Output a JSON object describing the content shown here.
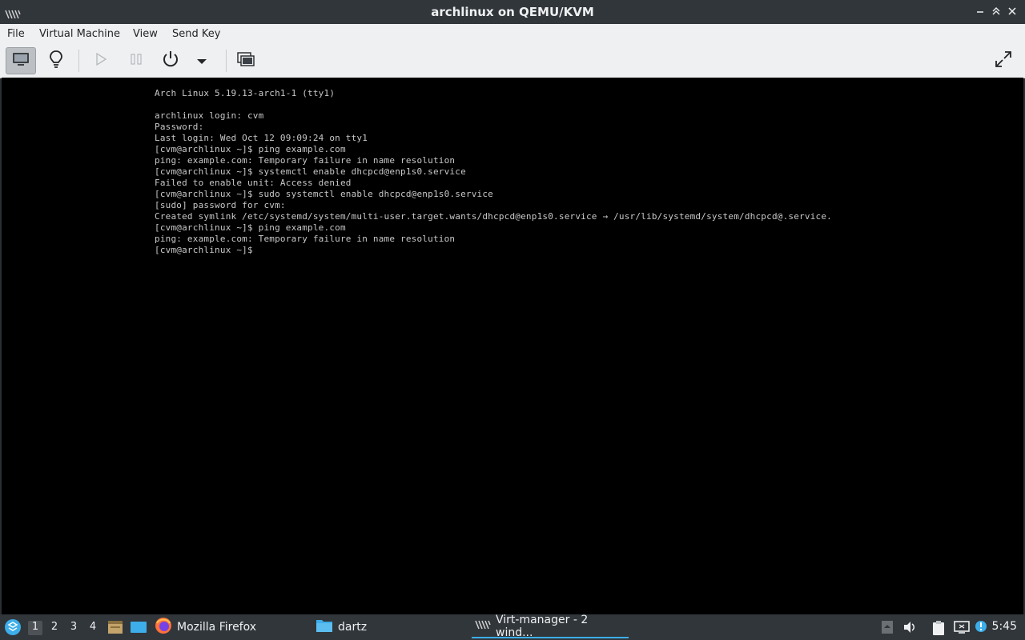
{
  "window": {
    "title": "archlinux on QEMU/KVM"
  },
  "menubar": {
    "items": [
      "File",
      "Virtual Machine",
      "View",
      "Send Key"
    ]
  },
  "toolbar": {
    "buttons": [
      "console-view",
      "details-view",
      "run",
      "pause",
      "shutdown",
      "shutdown-menu",
      "snapshots",
      "fullscreen"
    ]
  },
  "console": {
    "lines": [
      "Arch Linux 5.19.13-arch1-1 (tty1)",
      "",
      "archlinux login: cvm",
      "Password:",
      "Last login: Wed Oct 12 09:09:24 on tty1",
      "[cvm@archlinux ~]$ ping example.com",
      "ping: example.com: Temporary failure in name resolution",
      "[cvm@archlinux ~]$ systemctl enable dhcpcd@enp1s0.service",
      "Failed to enable unit: Access denied",
      "[cvm@archlinux ~]$ sudo systemctl enable dhcpcd@enp1s0.service",
      "[sudo] password for cvm:",
      "Created symlink /etc/systemd/system/multi-user.target.wants/dhcpcd@enp1s0.service → /usr/lib/systemd/system/dhcpcd@.service.",
      "[cvm@archlinux ~]$ ping example.com",
      "ping: example.com: Temporary failure in name resolution",
      "[cvm@archlinux ~]$ "
    ]
  },
  "taskbar": {
    "desktops": [
      "1",
      "2",
      "3",
      "4"
    ],
    "active_desktop": "1",
    "tasks": [
      {
        "label": "Mozilla Firefox",
        "icon": "firefox-icon"
      },
      {
        "label": "dartz",
        "icon": "folder-icon"
      },
      {
        "label": "Virt-manager - 2 wind...",
        "icon": "virt-manager-icon",
        "active": true
      }
    ],
    "clock": "5:45"
  },
  "colors": {
    "accent": "#3daee9",
    "titlebar": "#31363b",
    "console_bg": "#000000",
    "console_fg": "#c8c8c8"
  }
}
